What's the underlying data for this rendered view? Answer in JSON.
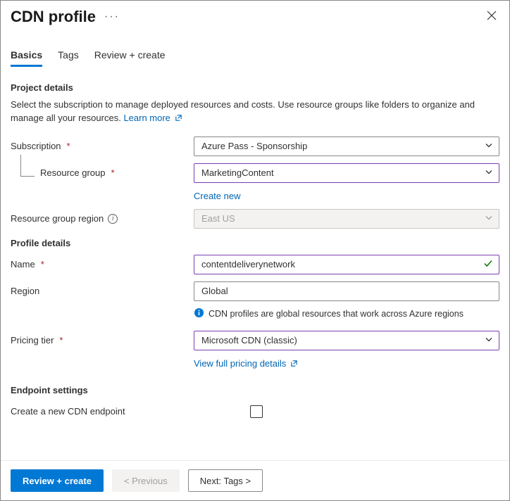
{
  "header": {
    "title": "CDN profile"
  },
  "tabs": {
    "basics": "Basics",
    "tags": "Tags",
    "review": "Review + create"
  },
  "project": {
    "heading": "Project details",
    "description": "Select the subscription to manage deployed resources and costs. Use resource groups like folders to organize and manage all your resources.",
    "learn_more": "Learn more",
    "subscription_label": "Subscription",
    "subscription_value": "Azure Pass - Sponsorship",
    "resource_group_label": "Resource group",
    "resource_group_value": "MarketingContent",
    "create_new": "Create new",
    "rg_region_label": "Resource group region",
    "rg_region_value": "East US"
  },
  "profile": {
    "heading": "Profile details",
    "name_label": "Name",
    "name_value": "contentdeliverynetwork",
    "region_label": "Region",
    "region_value": "Global",
    "region_info": "CDN profiles are global resources that work across Azure regions",
    "pricing_label": "Pricing tier",
    "pricing_value": "Microsoft CDN (classic)",
    "pricing_link": "View full pricing details"
  },
  "endpoint": {
    "heading": "Endpoint settings",
    "create_label": "Create a new CDN endpoint"
  },
  "footer": {
    "review": "Review + create",
    "previous": "< Previous",
    "next": "Next: Tags >"
  }
}
